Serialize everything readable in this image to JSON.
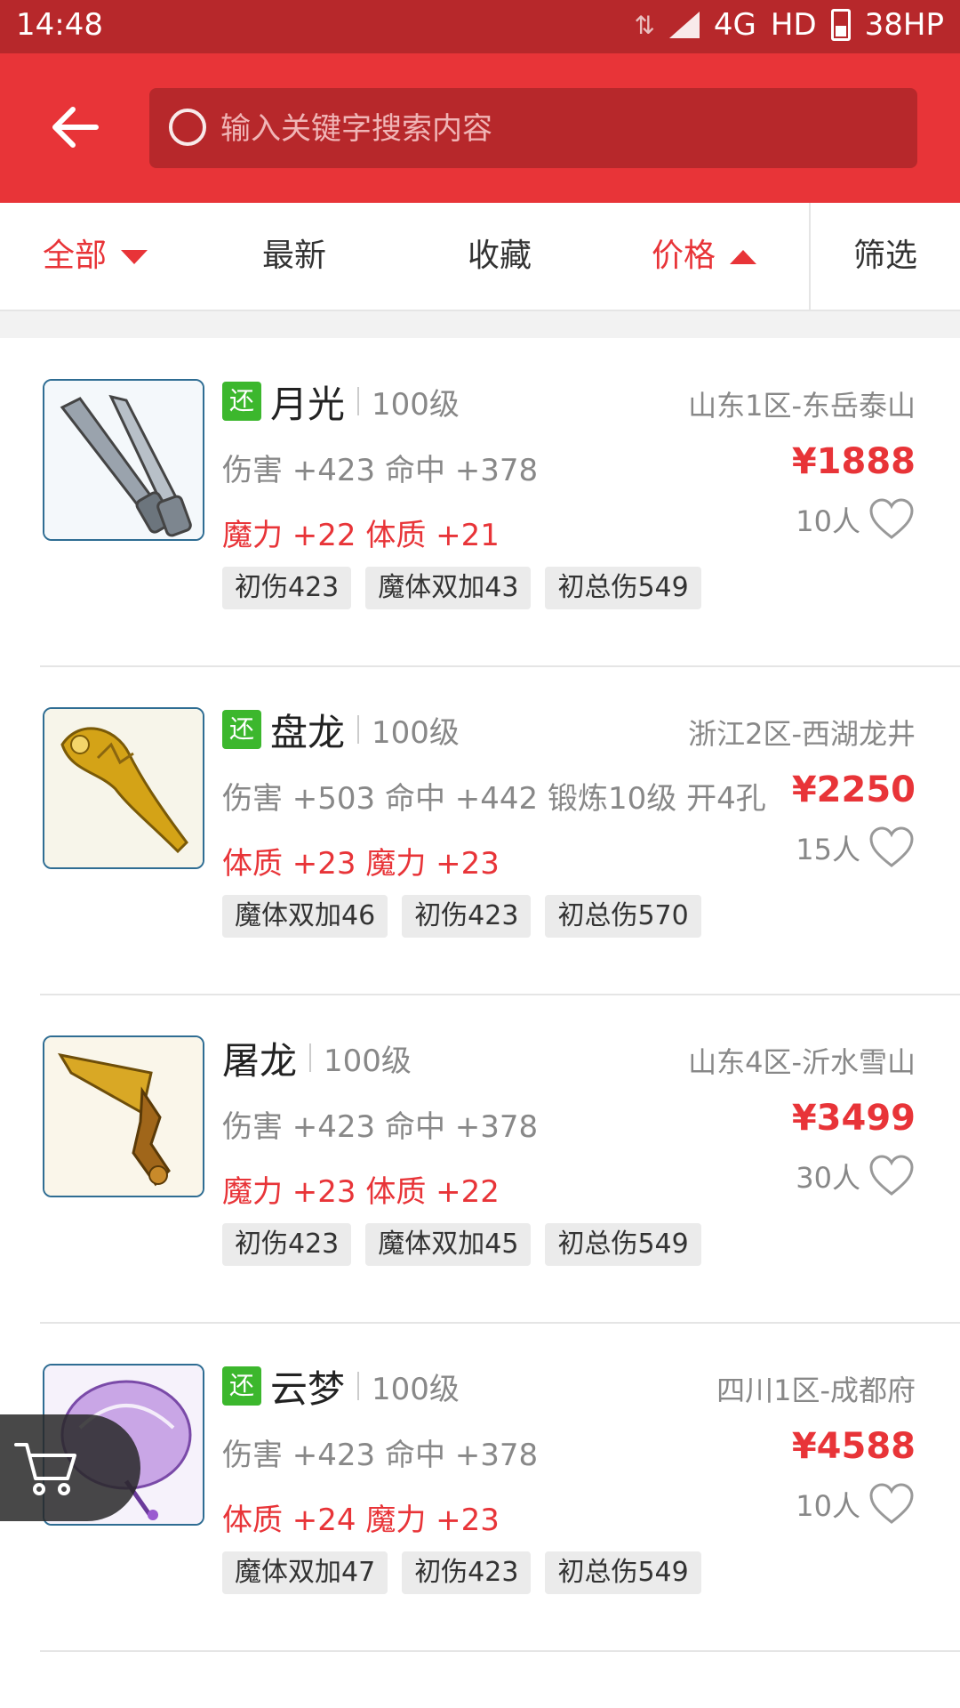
{
  "status": {
    "time": "14:48",
    "network": "4G",
    "hd": "HD",
    "battery": "38HP"
  },
  "search": {
    "placeholder": "输入关键字搜索内容"
  },
  "tabs": {
    "all": "全部",
    "latest": "最新",
    "favorites": "收藏",
    "price": "价格",
    "filter": "筛选"
  },
  "items": [
    {
      "badge": "还",
      "name": "月光",
      "level": "100级",
      "server": "山东1区-东岳泰山",
      "stats": "伤害 +423 命中 +378",
      "price": "¥1888",
      "attrs": "魔力 +22 体质 +21",
      "likes": "10人",
      "chips": [
        "初伤423",
        "魔体双加43",
        "初总伤549"
      ]
    },
    {
      "badge": "还",
      "name": "盘龙",
      "level": "100级",
      "server": "浙江2区-西湖龙井",
      "stats": "伤害 +503 命中 +442 锻炼10级 开4孔",
      "price": "¥2250",
      "attrs": "体质 +23 魔力 +23",
      "likes": "15人",
      "chips": [
        "魔体双加46",
        "初伤423",
        "初总伤570"
      ]
    },
    {
      "badge": "",
      "name": "屠龙",
      "level": "100级",
      "server": "山东4区-沂水雪山",
      "stats": "伤害 +423 命中 +378",
      "price": "¥3499",
      "attrs": "魔力 +23 体质 +22",
      "likes": "30人",
      "chips": [
        "初伤423",
        "魔体双加45",
        "初总伤549"
      ]
    },
    {
      "badge": "还",
      "name": "云梦",
      "level": "100级",
      "server": "四川1区-成都府",
      "stats": "伤害 +423 命中 +378",
      "price": "¥4588",
      "attrs": "体质 +24 魔力 +23",
      "likes": "10人",
      "chips": [
        "魔体双加47",
        "初伤423",
        "初总伤549"
      ]
    }
  ],
  "colors": {
    "primary": "#e83438",
    "status_bar": "#b7282b",
    "badge_green": "#3cb72d"
  }
}
